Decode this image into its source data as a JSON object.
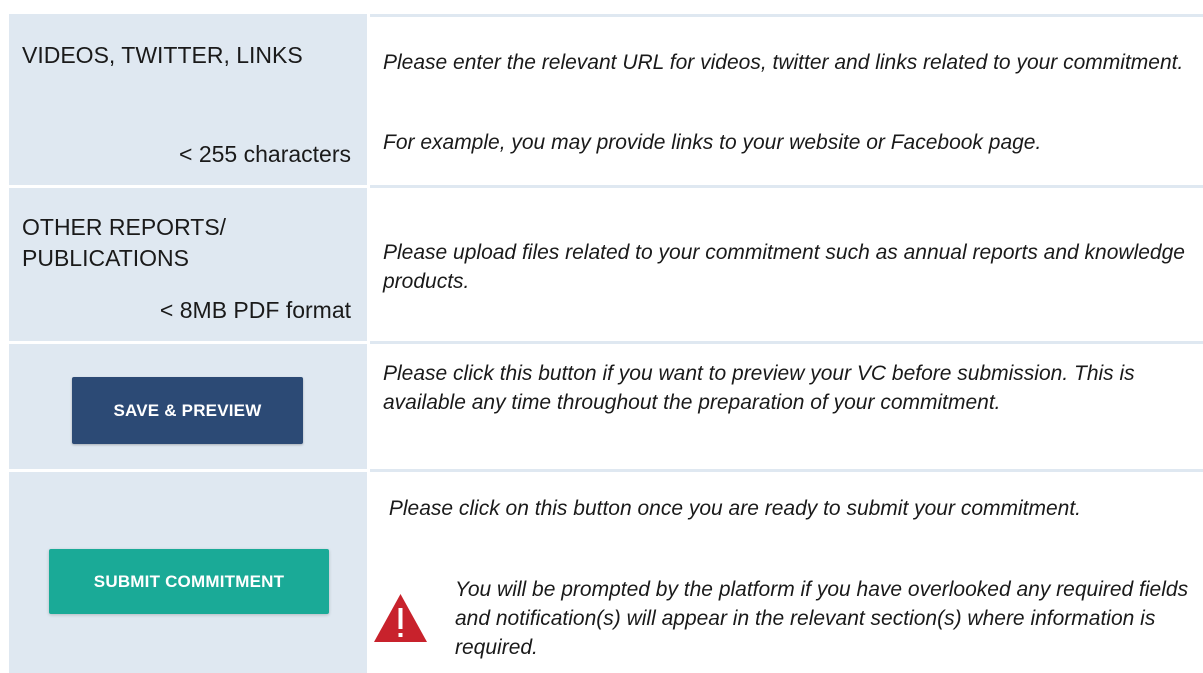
{
  "rows": [
    {
      "label": "VIDEOS, TWITTER, LINKS",
      "sublabel": "< 255 characters",
      "desc": [
        "Please enter the relevant URL for videos, twitter and links related to your commitment.",
        "For example, you may provide links to your website or Facebook page."
      ]
    },
    {
      "label": "OTHER REPORTS/ PUBLICATIONS",
      "sublabel": "< 8MB PDF format",
      "desc": [
        "Please upload files related to your commitment such as annual reports and knowledge products."
      ]
    },
    {
      "button_label": "SAVE & PREVIEW",
      "desc": [
        "Please click this button if you want to preview your VC before submission. This is available any time throughout the preparation of your commitment."
      ]
    },
    {
      "button_label": "SUBMIT COMMITMENT",
      "desc": [
        " Please click on this button once you are ready to submit your commitment.",
        "You will be prompted by the platform if you have overlooked any required fields and notification(s) will appear in the relevant section(s) where information is required."
      ]
    }
  ],
  "icons": {
    "warning": "warning-triangle-icon"
  },
  "colors": {
    "label_column_bg": "#dfe8f1",
    "preview_button_bg": "#2c4a75",
    "submit_button_bg": "#1aaa97",
    "warning_icon": "#c8222c"
  }
}
